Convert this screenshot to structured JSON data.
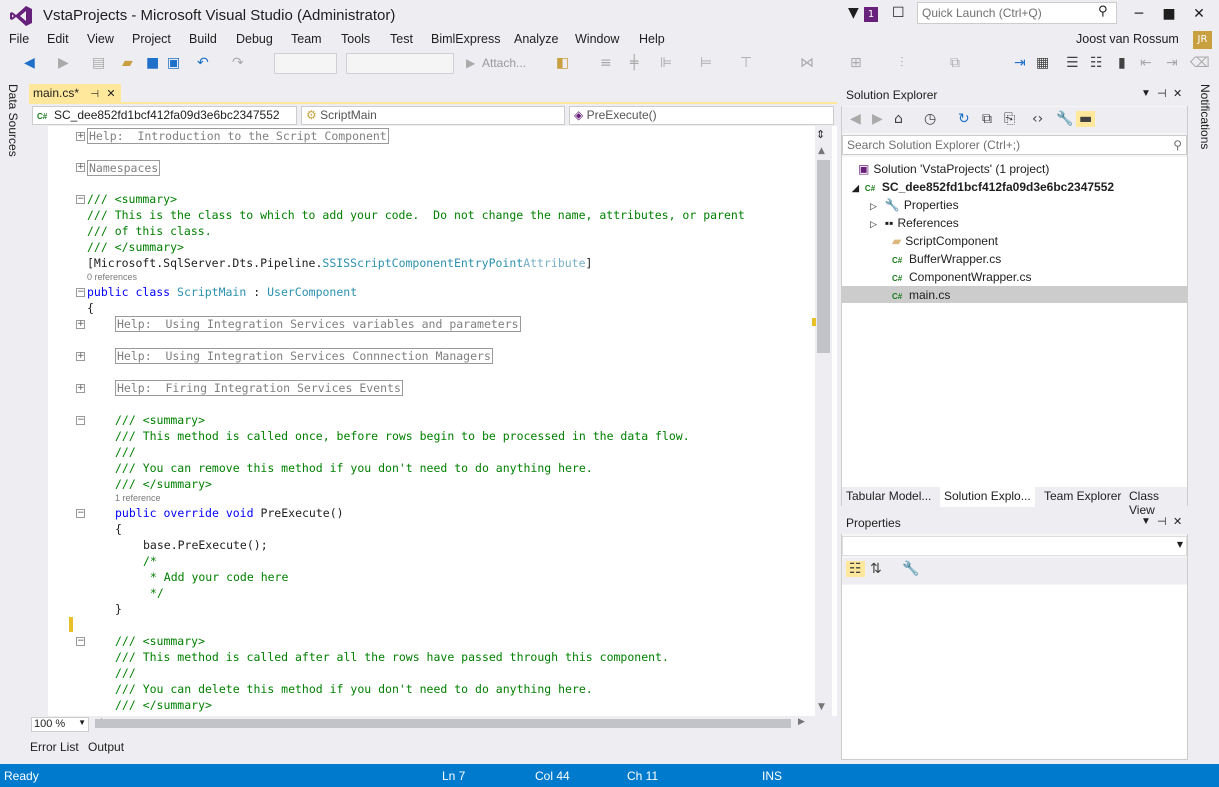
{
  "window": {
    "title": "VstaProjects - Microsoft Visual Studio (Administrator)",
    "notification_count": "1",
    "quick_launch_placeholder": "Quick Launch (Ctrl+Q)"
  },
  "menu": [
    "File",
    "Edit",
    "View",
    "Project",
    "Build",
    "Debug",
    "Team",
    "Tools",
    "Test",
    "BimlExpress",
    "Analyze",
    "Window",
    "Help"
  ],
  "user": {
    "name": "Joost van Rossum",
    "initials": "JR"
  },
  "toolbar": {
    "attach_label": "Attach..."
  },
  "side": {
    "left": "Data Sources",
    "right": "Notifications"
  },
  "editor": {
    "tab_label": "main.cs*",
    "nav": {
      "project": "SC_dee852fd1bcf412fa09d3e6bc2347552",
      "class": "ScriptMain",
      "member": "PreExecute()"
    },
    "zoom": "100 %",
    "refs0": "0 references",
    "refs1": "1 reference",
    "code": {
      "help_intro": "Help:  Introduction to the Script Component",
      "namespaces": "Namespaces",
      "c1": "/// <summary>",
      "c2": "/// This is the class to which to add your code.  Do not change the name, attributes, or parent",
      "c3": "/// of this class.",
      "c4": "/// </summary>",
      "attr_a": "[Microsoft.SqlServer.Dts.Pipeline.",
      "attr_b": "SSISScriptComponentEntryPoint",
      "attr_c": "Attribute",
      "attr_d": "]",
      "kw_public": "public",
      "kw_class": "class",
      "cls_name": "ScriptMain",
      "colon": ":",
      "base": "UserComponent",
      "ob": "{",
      "cb": "}",
      "help_vars": "Help:  Using Integration Services variables and parameters",
      "help_conn": "Help:  Using Integration Services Connnection Managers",
      "help_events": "Help:  Firing Integration Services Events",
      "m1": "/// <summary>",
      "m2": "/// This method is called once, before rows begin to be processed in the data flow.",
      "m3": "///",
      "m4": "/// You can remove this method if you don't need to do anything here.",
      "m5": "/// </summary>",
      "kw_override": "override",
      "kw_void": "void",
      "method": "PreExecute()",
      "base_call": "base.PreExecute();",
      "bc1": "/*",
      "bc2": " * Add your code here",
      "bc3": " */",
      "p1": "/// <summary>",
      "p2": "/// This method is called after all the rows have passed through this component.",
      "p3": "///",
      "p4": "/// You can delete this method if you don't need to do anything here.",
      "p5": "/// </summary>"
    }
  },
  "solution_explorer": {
    "title": "Solution Explorer",
    "search_placeholder": "Search Solution Explorer (Ctrl+;)",
    "solution": "Solution 'VstaProjects' (1 project)",
    "project": "SC_dee852fd1bcf412fa09d3e6bc2347552",
    "items": [
      "Properties",
      "References",
      "ScriptComponent",
      "BufferWrapper.cs",
      "ComponentWrapper.cs",
      "main.cs"
    ],
    "tabs": [
      "Tabular Model...",
      "Solution Explo...",
      "Team Explorer",
      "Class View"
    ]
  },
  "properties": {
    "title": "Properties"
  },
  "bottom_tabs": [
    "Error List",
    "Output"
  ],
  "status": {
    "ready": "Ready",
    "ln": "Ln 7",
    "col": "Col 44",
    "ch": "Ch 11",
    "mode": "INS"
  }
}
